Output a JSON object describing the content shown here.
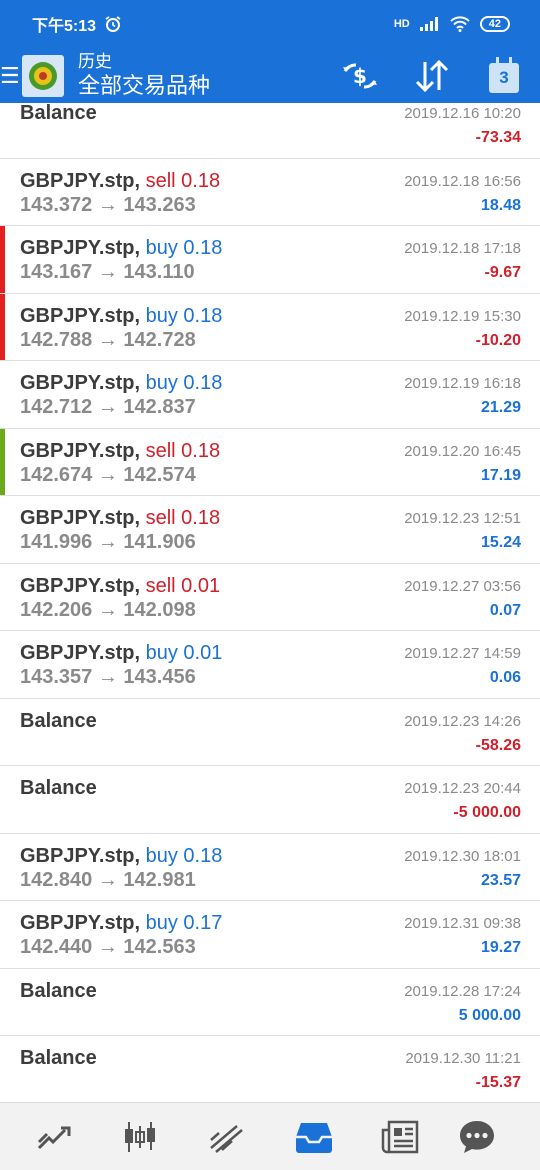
{
  "status_bar": {
    "time": "下午5:13",
    "network": "HD",
    "battery": "42"
  },
  "header": {
    "title": "历史",
    "subtitle": "全部交易品种",
    "calendar_day": "3",
    "brand_color": "#1a72d9"
  },
  "rows": [
    {
      "label": "Balance",
      "time": "2019.12.16 10:20",
      "profit": "-73.34",
      "sign": "neg"
    },
    {
      "symbol": "GBPJPY.stp,",
      "side": "sell 0.18",
      "open": "143.372",
      "close": "143.263",
      "time": "2019.12.18 16:56",
      "profit": "18.48",
      "sign": "pos"
    },
    {
      "symbol": "GBPJPY.stp,",
      "side": "buy 0.18",
      "open": "143.167",
      "close": "143.110",
      "time": "2019.12.18 17:18",
      "profit": "-9.67",
      "sign": "neg",
      "marker": "#e1201f"
    },
    {
      "symbol": "GBPJPY.stp,",
      "side": "buy 0.18",
      "open": "142.788",
      "close": "142.728",
      "time": "2019.12.19 15:30",
      "profit": "-10.20",
      "sign": "neg",
      "marker": "#e1201f"
    },
    {
      "symbol": "GBPJPY.stp,",
      "side": "buy 0.18",
      "open": "142.712",
      "close": "142.837",
      "time": "2019.12.19 16:18",
      "profit": "21.29",
      "sign": "pos"
    },
    {
      "symbol": "GBPJPY.stp,",
      "side": "sell 0.18",
      "open": "142.674",
      "close": "142.574",
      "time": "2019.12.20 16:45",
      "profit": "17.19",
      "sign": "pos",
      "marker": "#6aaa1a"
    },
    {
      "symbol": "GBPJPY.stp,",
      "side": "sell 0.18",
      "open": "141.996",
      "close": "141.906",
      "time": "2019.12.23 12:51",
      "profit": "15.24",
      "sign": "pos"
    },
    {
      "symbol": "GBPJPY.stp,",
      "side": "sell 0.01",
      "open": "142.206",
      "close": "142.098",
      "time": "2019.12.27 03:56",
      "profit": "0.07",
      "sign": "pos"
    },
    {
      "symbol": "GBPJPY.stp,",
      "side": "buy 0.01",
      "open": "143.357",
      "close": "143.456",
      "time": "2019.12.27 14:59",
      "profit": "0.06",
      "sign": "pos"
    },
    {
      "label": "Balance",
      "time": "2019.12.23 14:26",
      "profit": "-58.26",
      "sign": "neg"
    },
    {
      "label": "Balance",
      "time": "2019.12.23 20:44",
      "profit": "-5 000.00",
      "sign": "neg"
    },
    {
      "symbol": "GBPJPY.stp,",
      "side": "buy 0.18",
      "open": "142.840",
      "close": "142.981",
      "time": "2019.12.30 18:01",
      "profit": "23.57",
      "sign": "pos"
    },
    {
      "symbol": "GBPJPY.stp,",
      "side": "buy 0.17",
      "open": "142.440",
      "close": "142.563",
      "time": "2019.12.31 09:38",
      "profit": "19.27",
      "sign": "pos"
    },
    {
      "label": "Balance",
      "time": "2019.12.28 17:24",
      "profit": "5 000.00",
      "sign": "pos"
    },
    {
      "label": "Balance",
      "time": "2019.12.30 11:21",
      "profit": "-15.37",
      "sign": "neg"
    }
  ],
  "bottom_nav": [
    {
      "icon": "quotes-icon"
    },
    {
      "icon": "chart-icon"
    },
    {
      "icon": "trade-icon"
    },
    {
      "icon": "history-icon",
      "active": true
    },
    {
      "icon": "news-icon"
    },
    {
      "icon": "chat-icon"
    }
  ],
  "colors": {
    "sell": "#d21f2a",
    "buy": "#1a72d9",
    "negative": "#d21f2a",
    "positive": "#1a72d9"
  }
}
